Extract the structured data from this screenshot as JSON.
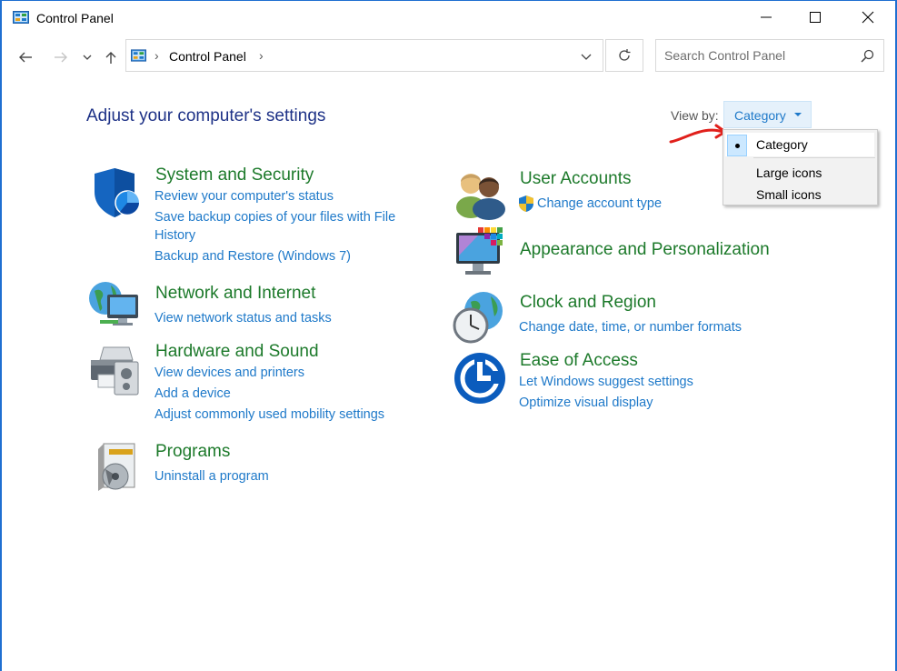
{
  "window": {
    "title": "Control Panel"
  },
  "address": {
    "path": "Control Panel",
    "search_placeholder": "Search Control Panel"
  },
  "page": {
    "heading": "Adjust your computer's settings",
    "view_by_label": "View by:",
    "view_by_value": "Category"
  },
  "view_menu": {
    "items": [
      "Category",
      "Large icons",
      "Small icons"
    ],
    "selected": "Category"
  },
  "categories": {
    "system_security": {
      "title": "System and Security",
      "links": [
        "Review your computer's status",
        "Save backup copies of your files with File",
        "History",
        "Backup and Restore (Windows 7)"
      ]
    },
    "network_internet": {
      "title": "Network and Internet",
      "links": [
        "View network status and tasks"
      ]
    },
    "hardware_sound": {
      "title": "Hardware and Sound",
      "links": [
        "View devices and printers",
        "Add a device",
        "Adjust commonly used mobility settings"
      ]
    },
    "programs": {
      "title": "Programs",
      "links": [
        "Uninstall a program"
      ]
    },
    "user_accounts": {
      "title": "User Accounts",
      "links": [
        "Change account type"
      ]
    },
    "appearance": {
      "title": "Appearance and Personalization"
    },
    "clock_region": {
      "title": "Clock and Region",
      "links": [
        "Change date, time, or number formats"
      ]
    },
    "ease_access": {
      "title": "Ease of Access",
      "links": [
        "Let Windows suggest settings",
        "Optimize visual display"
      ]
    }
  },
  "colors": {
    "heading": "#1e3287",
    "category_title": "#1d7a2b",
    "link": "#1e79c9",
    "window_border": "#1f6fd1",
    "annotation": "#e0201b"
  }
}
